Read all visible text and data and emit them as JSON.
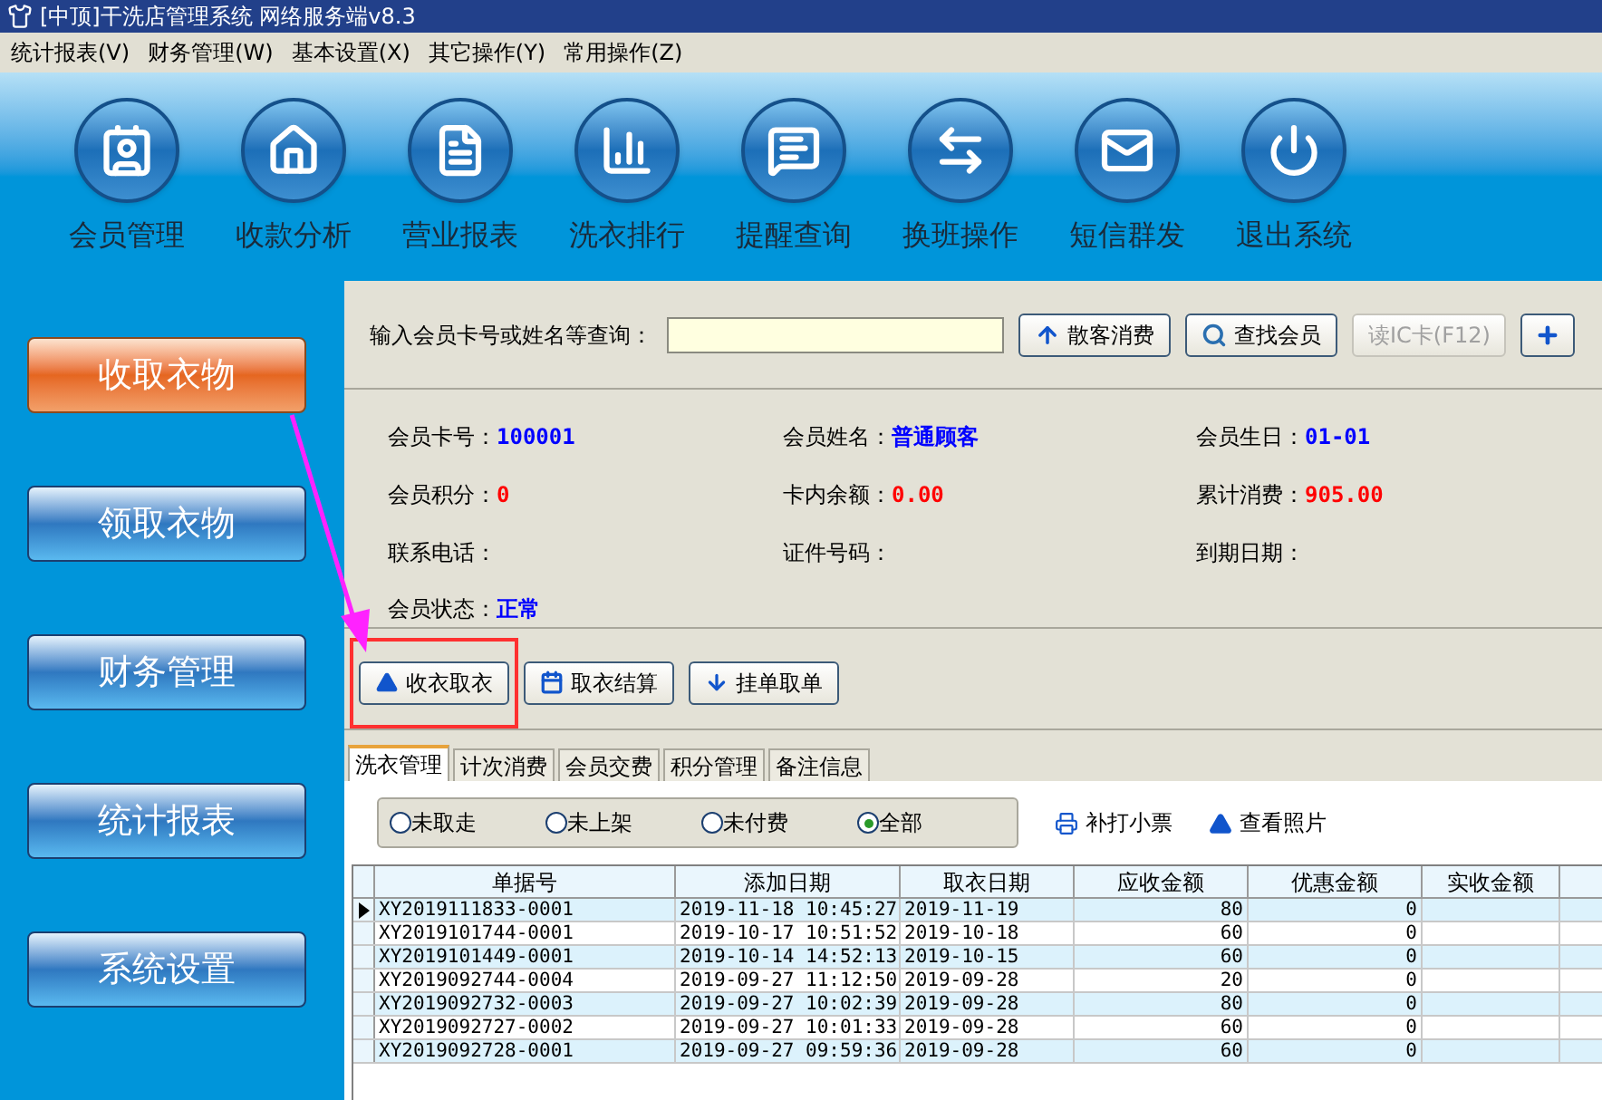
{
  "window": {
    "title": "[中顶]干洗店管理系统 网络服务端v8.3"
  },
  "menu": [
    "统计报表(V)",
    "财务管理(W)",
    "基本设置(X)",
    "其它操作(Y)",
    "常用操作(Z)"
  ],
  "toolbar": [
    "会员管理",
    "收款分析",
    "营业报表",
    "洗衣排行",
    "提醒查询",
    "换班操作",
    "短信群发",
    "退出系统"
  ],
  "sidebar": {
    "items": [
      {
        "label": "收取衣物",
        "selected": true
      },
      {
        "label": "领取衣物",
        "selected": false
      },
      {
        "label": "财务管理",
        "selected": false
      },
      {
        "label": "统计报表",
        "selected": false
      },
      {
        "label": "系统设置",
        "selected": false
      }
    ]
  },
  "search": {
    "label": "输入会员卡号或姓名等查询：",
    "buttons": [
      {
        "label": "散客消费",
        "disabled": false
      },
      {
        "label": "查找会员",
        "disabled": false
      },
      {
        "label": "读IC卡(F12)",
        "disabled": true
      }
    ]
  },
  "member_fields": [
    {
      "label": "会员卡号：",
      "value": "100001",
      "color": "#0000ff"
    },
    {
      "label": "会员姓名：",
      "value": "普通顾客",
      "color": "#0000ff"
    },
    {
      "label": "会员生日：",
      "value": "01-01",
      "color": "#0000ff"
    },
    {
      "label": "会员积分：",
      "value": "0",
      "color": "#ff0000"
    },
    {
      "label": "卡内余额：",
      "value": "0.00",
      "color": "#ff0000"
    },
    {
      "label": "累计消费：",
      "value": "905.00",
      "color": "#ff0000"
    },
    {
      "label": "联系电话："
    },
    {
      "label": "证件号码："
    },
    {
      "label": "到期日期："
    },
    {
      "label": "会员状态：",
      "value": "正常",
      "color": "#0000ff"
    }
  ],
  "actions": [
    {
      "label": "收衣取衣",
      "highlighted": true
    },
    {
      "label": "取衣结算",
      "highlighted": false
    },
    {
      "label": "挂单取单",
      "highlighted": false
    }
  ],
  "tabs": [
    {
      "label": "洗衣管理",
      "selected": true
    },
    {
      "label": "计次消费",
      "selected": false
    },
    {
      "label": "会员交费",
      "selected": false
    },
    {
      "label": "积分管理",
      "selected": false
    },
    {
      "label": "备注信息",
      "selected": false
    }
  ],
  "filters": [
    {
      "label": "未取走",
      "selected": false
    },
    {
      "label": "未上架",
      "selected": false
    },
    {
      "label": "未付费",
      "selected": false
    },
    {
      "label": "全部",
      "selected": true
    }
  ],
  "filter_buttons": [
    "补打小票",
    "查看照片"
  ],
  "table": {
    "columns": [
      "单据号",
      "添加日期",
      "取衣日期",
      "应收金额",
      "优惠金额",
      "实收金额"
    ],
    "rows": [
      {
        "cells": [
          "XY2019111833-0001",
          "2019-11-18 10:45:27",
          "2019-11-19",
          "80",
          "0"
        ],
        "selected": true
      },
      {
        "cells": [
          "XY2019101744-0001",
          "2019-10-17 10:51:52",
          "2019-10-18",
          "60",
          "0"
        ],
        "selected": false
      },
      {
        "cells": [
          "XY2019101449-0001",
          "2019-10-14 14:52:13",
          "2019-10-15",
          "60",
          "0"
        ],
        "selected": false
      },
      {
        "cells": [
          "XY2019092744-0004",
          "2019-09-27 11:12:50",
          "2019-09-28",
          "20",
          "0"
        ],
        "selected": false
      },
      {
        "cells": [
          "XY2019092732-0003",
          "2019-09-27 10:02:39",
          "2019-09-28",
          "80",
          "0"
        ],
        "selected": false
      },
      {
        "cells": [
          "XY2019092727-0002",
          "2019-09-27 10:01:33",
          "2019-09-28",
          "60",
          "0"
        ],
        "selected": false
      },
      {
        "cells": [
          "XY2019092728-0001",
          "2019-09-27 09:59:36",
          "2019-09-28",
          "60",
          "0"
        ],
        "selected": false
      }
    ]
  }
}
